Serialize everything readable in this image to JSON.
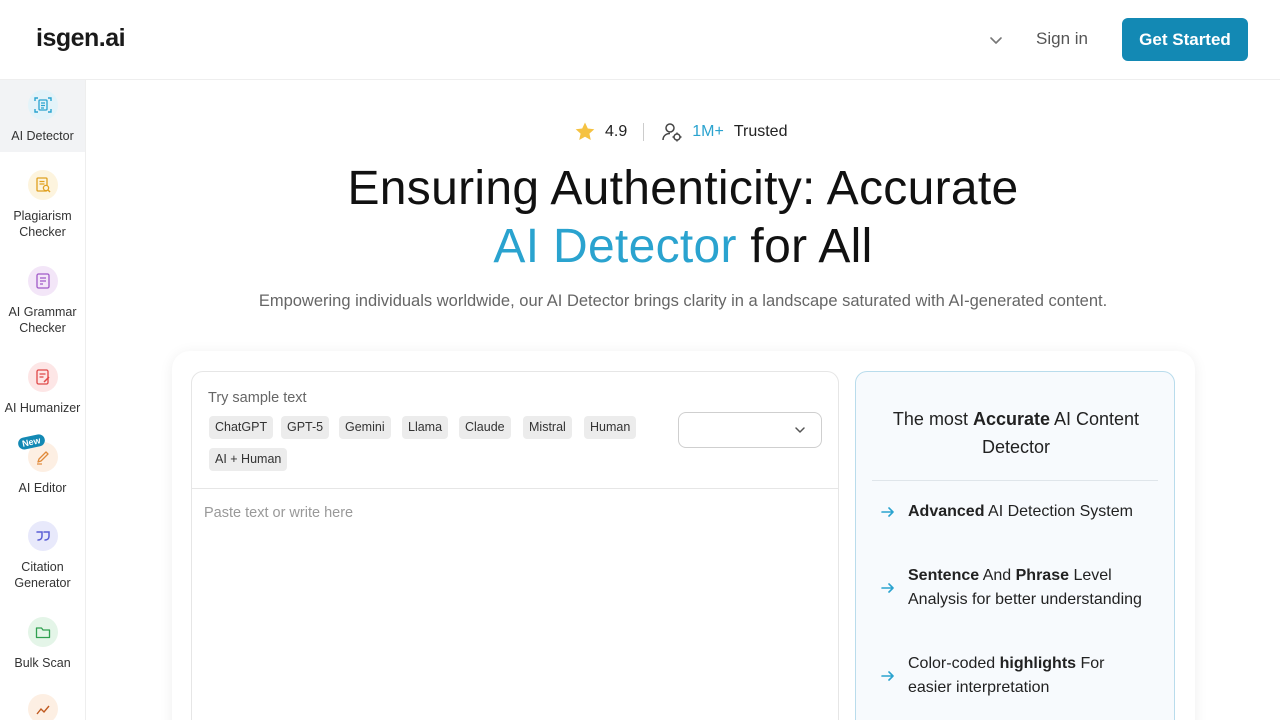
{
  "header": {
    "logo": "isgen.ai",
    "sign_in": "Sign in",
    "get_started": "Get Started"
  },
  "sidebar": {
    "items": [
      {
        "label": "AI Detector",
        "icon": "document-scan-icon",
        "active": true,
        "color": "#2aa3cf"
      },
      {
        "label": "Plagiarism Checker",
        "icon": "document-search-icon",
        "color": "#e0a020"
      },
      {
        "label": "AI Grammar Checker",
        "icon": "grammar-document-icon",
        "color": "#a05ac8"
      },
      {
        "label": "AI Humanizer",
        "icon": "humanizer-document-icon",
        "color": "#e04848"
      },
      {
        "label": "AI Editor",
        "icon": "pencil-edit-icon",
        "badge": "New",
        "color": "#e08a3a"
      },
      {
        "label": "Citation Generator",
        "icon": "quote-icon",
        "color": "#5b5fd6"
      },
      {
        "label": "Bulk Scan",
        "icon": "folder-icon",
        "color": "#30a050"
      }
    ]
  },
  "hero": {
    "rating": "4.9",
    "trust_count": "1M+",
    "trust_label": "Trusted",
    "title_line1": "Ensuring Authenticity: Accurate",
    "title_accent": "AI Detector",
    "title_rest": " for All",
    "subtitle": "Empowering individuals worldwide, our AI Detector brings clarity in a landscape saturated with AI-generated content."
  },
  "editor": {
    "sample_label": "Try sample text",
    "chips": [
      "ChatGPT",
      "GPT-5",
      "Gemini",
      "Llama",
      "Claude",
      "Mistral",
      "Human",
      "AI + Human"
    ],
    "select_value": "",
    "placeholder": "Paste text or write here"
  },
  "info": {
    "title_pre": "The most ",
    "title_bold": "Accurate",
    "title_post": " AI Content Detector",
    "features": [
      {
        "b1": "Advanced",
        "t1": " AI Detection System",
        "b2": "",
        "t2": ""
      },
      {
        "b1": "Sentence",
        "t1": " And ",
        "b2": "Phrase",
        "t2": " Level Analysis for better understanding"
      },
      {
        "pre": "Color-coded ",
        "b1": "highlights",
        "t1": " For easier interpretation",
        "b2": "",
        "t2": ""
      }
    ]
  },
  "colors": {
    "brand": "#1389b4",
    "accent": "#2aa3cf",
    "star": "#f5c242"
  }
}
